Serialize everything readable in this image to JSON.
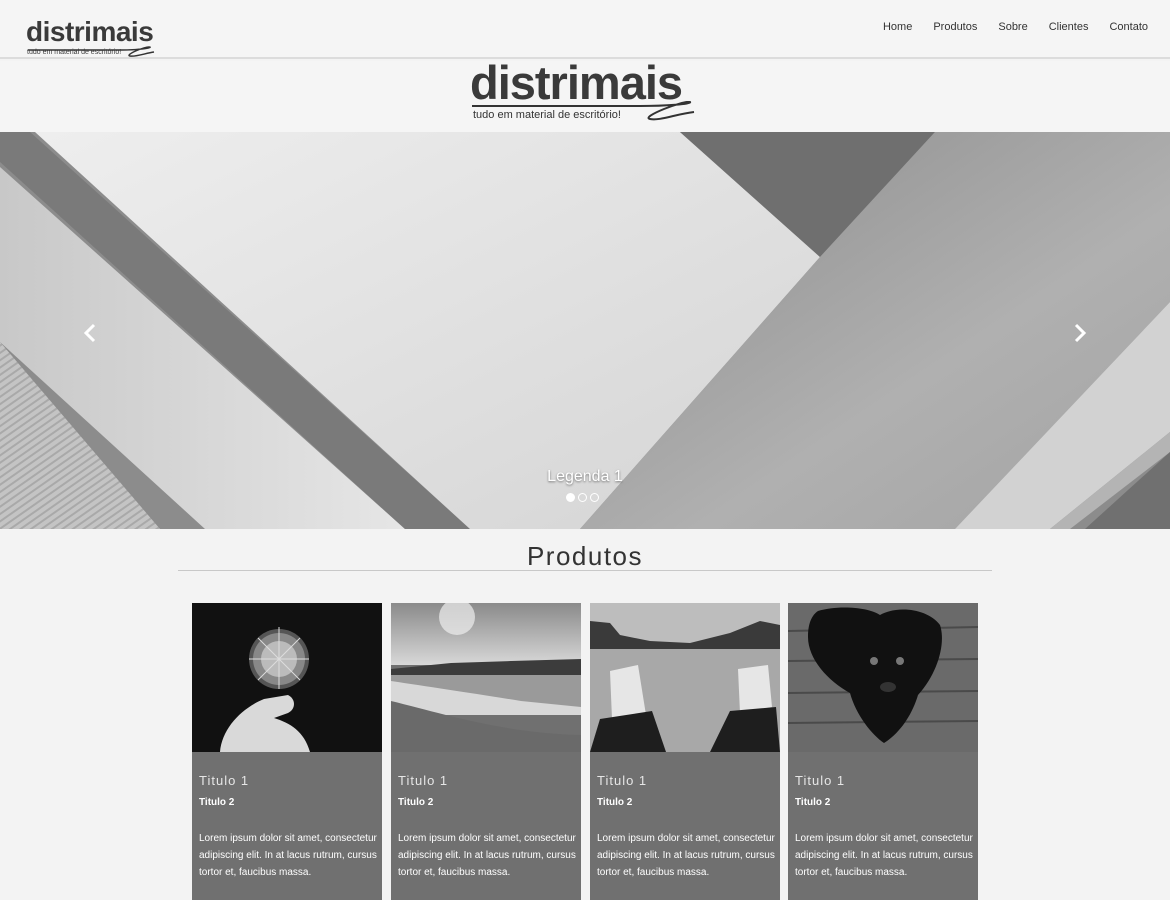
{
  "brand": {
    "name": "distrimais",
    "tagline": "tudo em material de escritório!"
  },
  "nav": {
    "items": [
      "Home",
      "Produtos",
      "Sobre",
      "Clientes",
      "Contato"
    ]
  },
  "carousel": {
    "caption": "Legenda 1",
    "prev_icon": "chevron-left-icon",
    "next_icon": "chevron-right-icon",
    "slides_count": 3,
    "active_slide": 1
  },
  "products": {
    "heading": "Produtos",
    "cards": [
      {
        "image": "dandelion-photo",
        "title1": "Titulo 1",
        "title2": "Titulo 2",
        "text": "Lorem ipsum dolor sit amet, consectetur adipiscing elit. In at lacus rutrum, cursus tortor et, faucibus massa."
      },
      {
        "image": "beach-photo",
        "title1": "Titulo 1",
        "title2": "Titulo 2",
        "text": "Lorem ipsum dolor sit amet, consectetur adipiscing elit. In at lacus rutrum, cursus tortor et, faucibus massa."
      },
      {
        "image": "sneakers-photo",
        "title1": "Titulo 1",
        "title2": "Titulo 2",
        "text": "Lorem ipsum dolor sit amet, consectetur adipiscing elit. In at lacus rutrum, cursus tortor et, faucibus massa."
      },
      {
        "image": "dog-photo",
        "title1": "Titulo 1",
        "title2": "Titulo 2",
        "text": "Lorem ipsum dolor sit amet, consectetur adipiscing elit. In at lacus rutrum, cursus tortor et, faucibus massa."
      }
    ]
  }
}
